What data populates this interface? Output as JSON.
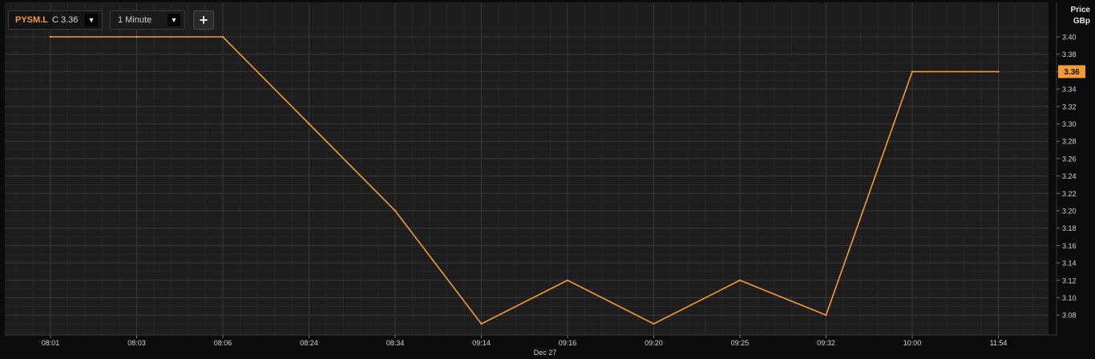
{
  "toolbar": {
    "symbol": "PYSM.L",
    "close_prefix": "C",
    "close_value": "3.36",
    "symbol_dropdown_icon": "caret-down-icon",
    "interval": "1 Minute",
    "interval_dropdown_icon": "caret-down-icon",
    "add_label": "+"
  },
  "axis": {
    "price_title": "Price",
    "price_unit": "GBp",
    "current_price_label": "3.36",
    "date_label": "Dec 27"
  },
  "colors": {
    "background": "#1d1d1d",
    "grid": "#333333",
    "line": "#f39b34",
    "badge": "#f39b34"
  },
  "chart_data": {
    "type": "line",
    "x": [
      "08:01",
      "08:03",
      "08:06",
      "08:24",
      "08:34",
      "09:14",
      "09:16",
      "09:20",
      "09:25",
      "09:32",
      "10:00",
      "11:54"
    ],
    "series": [
      {
        "values": [
          3.4,
          3.4,
          3.4,
          3.3,
          3.2,
          3.07,
          3.12,
          3.07,
          3.12,
          3.08,
          3.36,
          3.36
        ]
      }
    ],
    "y_ticks": [
      "3.40",
      "3.38",
      "3.36",
      "3.34",
      "3.32",
      "3.30",
      "3.28",
      "3.26",
      "3.24",
      "3.22",
      "3.20",
      "3.18",
      "3.16",
      "3.14",
      "3.12",
      "3.10",
      "3.08"
    ],
    "ylim": [
      3.06,
      3.41
    ],
    "y_axis_position": "right",
    "grid": true
  }
}
